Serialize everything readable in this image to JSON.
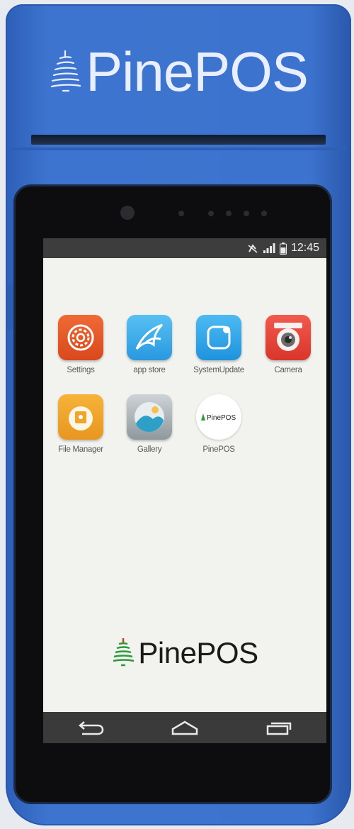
{
  "device": {
    "brand": "PinePOS"
  },
  "status_bar": {
    "time": "12:45",
    "icons": [
      "no-sound-icon",
      "signal-icon",
      "battery-icon"
    ]
  },
  "apps": [
    {
      "label": "Settings",
      "icon": "settings-icon",
      "color": "#e8572a"
    },
    {
      "label": "app store",
      "icon": "app-store-icon",
      "color": "#3aa9e8"
    },
    {
      "label": "SystemUpdate",
      "icon": "system-update-icon",
      "color": "#2fa7ea"
    },
    {
      "label": "Camera",
      "icon": "camera-icon",
      "color": "#e6463b"
    },
    {
      "label": "File Manager",
      "icon": "folder-icon",
      "color": "#f1a22a"
    },
    {
      "label": "Gallery",
      "icon": "gallery-icon",
      "color": "#9aa3a8"
    },
    {
      "label": "PinePOS",
      "icon": "pinepos-app-icon",
      "color": "#ffffff"
    }
  ],
  "wallpaper_brand": "PinePOS",
  "nav_bar": {
    "buttons": [
      "back-icon",
      "home-icon",
      "recent-apps-icon"
    ]
  }
}
